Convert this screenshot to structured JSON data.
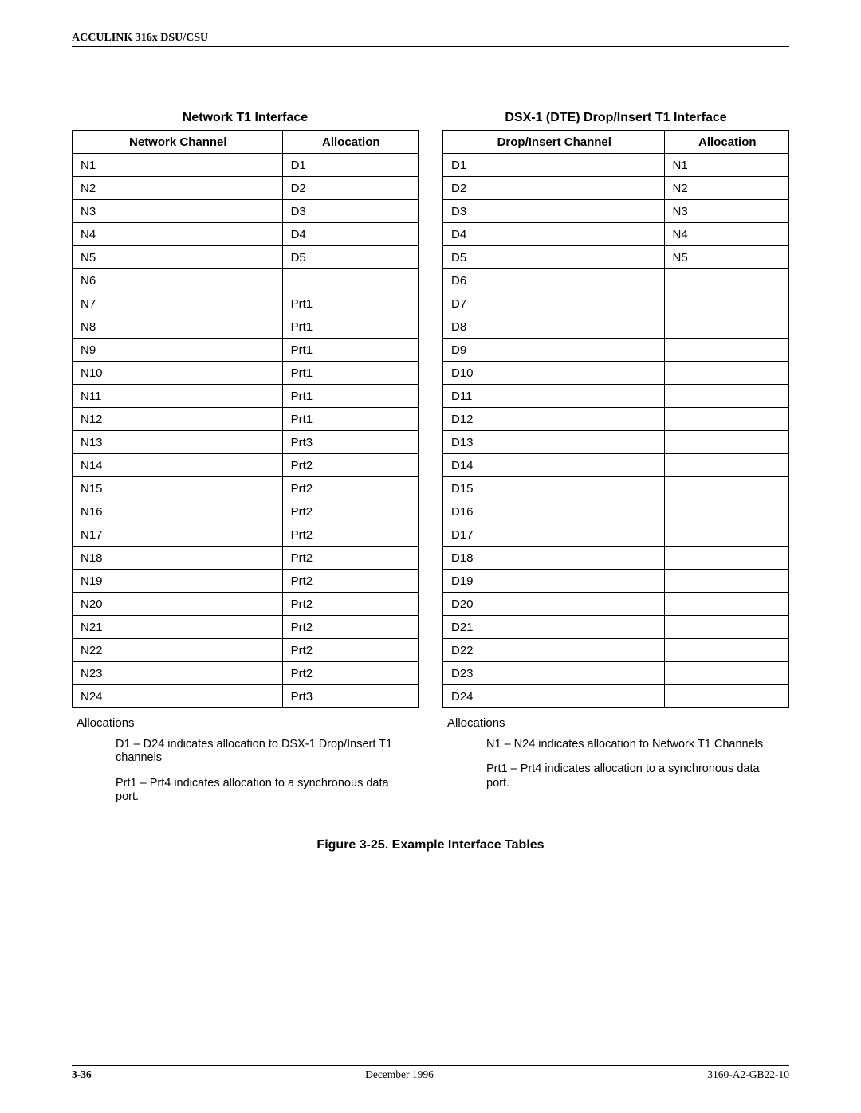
{
  "header": "ACCULINK 316x DSU/CSU",
  "left": {
    "title": "Network T1 Interface",
    "headers": [
      "Network Channel",
      "Allocation"
    ],
    "rows": [
      [
        "N1",
        "D1"
      ],
      [
        "N2",
        "D2"
      ],
      [
        "N3",
        "D3"
      ],
      [
        "N4",
        "D4"
      ],
      [
        "N5",
        "D5"
      ],
      [
        "N6",
        ""
      ],
      [
        "N7",
        "Prt1"
      ],
      [
        "N8",
        "Prt1"
      ],
      [
        "N9",
        "Prt1"
      ],
      [
        "N10",
        "Prt1"
      ],
      [
        "N11",
        "Prt1"
      ],
      [
        "N12",
        "Prt1"
      ],
      [
        "N13",
        "Prt3"
      ],
      [
        "N14",
        "Prt2"
      ],
      [
        "N15",
        "Prt2"
      ],
      [
        "N16",
        "Prt2"
      ],
      [
        "N17",
        "Prt2"
      ],
      [
        "N18",
        "Prt2"
      ],
      [
        "N19",
        "Prt2"
      ],
      [
        "N20",
        "Prt2"
      ],
      [
        "N21",
        "Prt2"
      ],
      [
        "N22",
        "Prt2"
      ],
      [
        "N23",
        "Prt2"
      ],
      [
        "N24",
        "Prt3"
      ]
    ],
    "alloc_label": "Allocations",
    "notes": [
      "D1 – D24 indicates allocation to DSX-1 Drop/Insert T1 channels",
      "Prt1 – Prt4 indicates allocation to a synchronous data port."
    ]
  },
  "right": {
    "title": "DSX-1 (DTE) Drop/Insert T1 Interface",
    "headers": [
      "Drop/Insert Channel",
      "Allocation"
    ],
    "rows": [
      [
        "D1",
        "N1"
      ],
      [
        "D2",
        "N2"
      ],
      [
        "D3",
        "N3"
      ],
      [
        "D4",
        "N4"
      ],
      [
        "D5",
        "N5"
      ],
      [
        "D6",
        ""
      ],
      [
        "D7",
        ""
      ],
      [
        "D8",
        ""
      ],
      [
        "D9",
        ""
      ],
      [
        "D10",
        ""
      ],
      [
        "D11",
        ""
      ],
      [
        "D12",
        ""
      ],
      [
        "D13",
        ""
      ],
      [
        "D14",
        ""
      ],
      [
        "D15",
        ""
      ],
      [
        "D16",
        ""
      ],
      [
        "D17",
        ""
      ],
      [
        "D18",
        ""
      ],
      [
        "D19",
        ""
      ],
      [
        "D20",
        ""
      ],
      [
        "D21",
        ""
      ],
      [
        "D22",
        ""
      ],
      [
        "D23",
        ""
      ],
      [
        "D24",
        ""
      ]
    ],
    "alloc_label": "Allocations",
    "notes": [
      "N1 – N24 indicates allocation to Network T1 Channels",
      "Prt1 – Prt4 indicates allocation to a synchronous data port."
    ]
  },
  "figure_caption": "Figure 3-25.  Example Interface Tables",
  "footer": {
    "page": "3-36",
    "date": "December 1996",
    "doc": "3160-A2-GB22-10"
  }
}
